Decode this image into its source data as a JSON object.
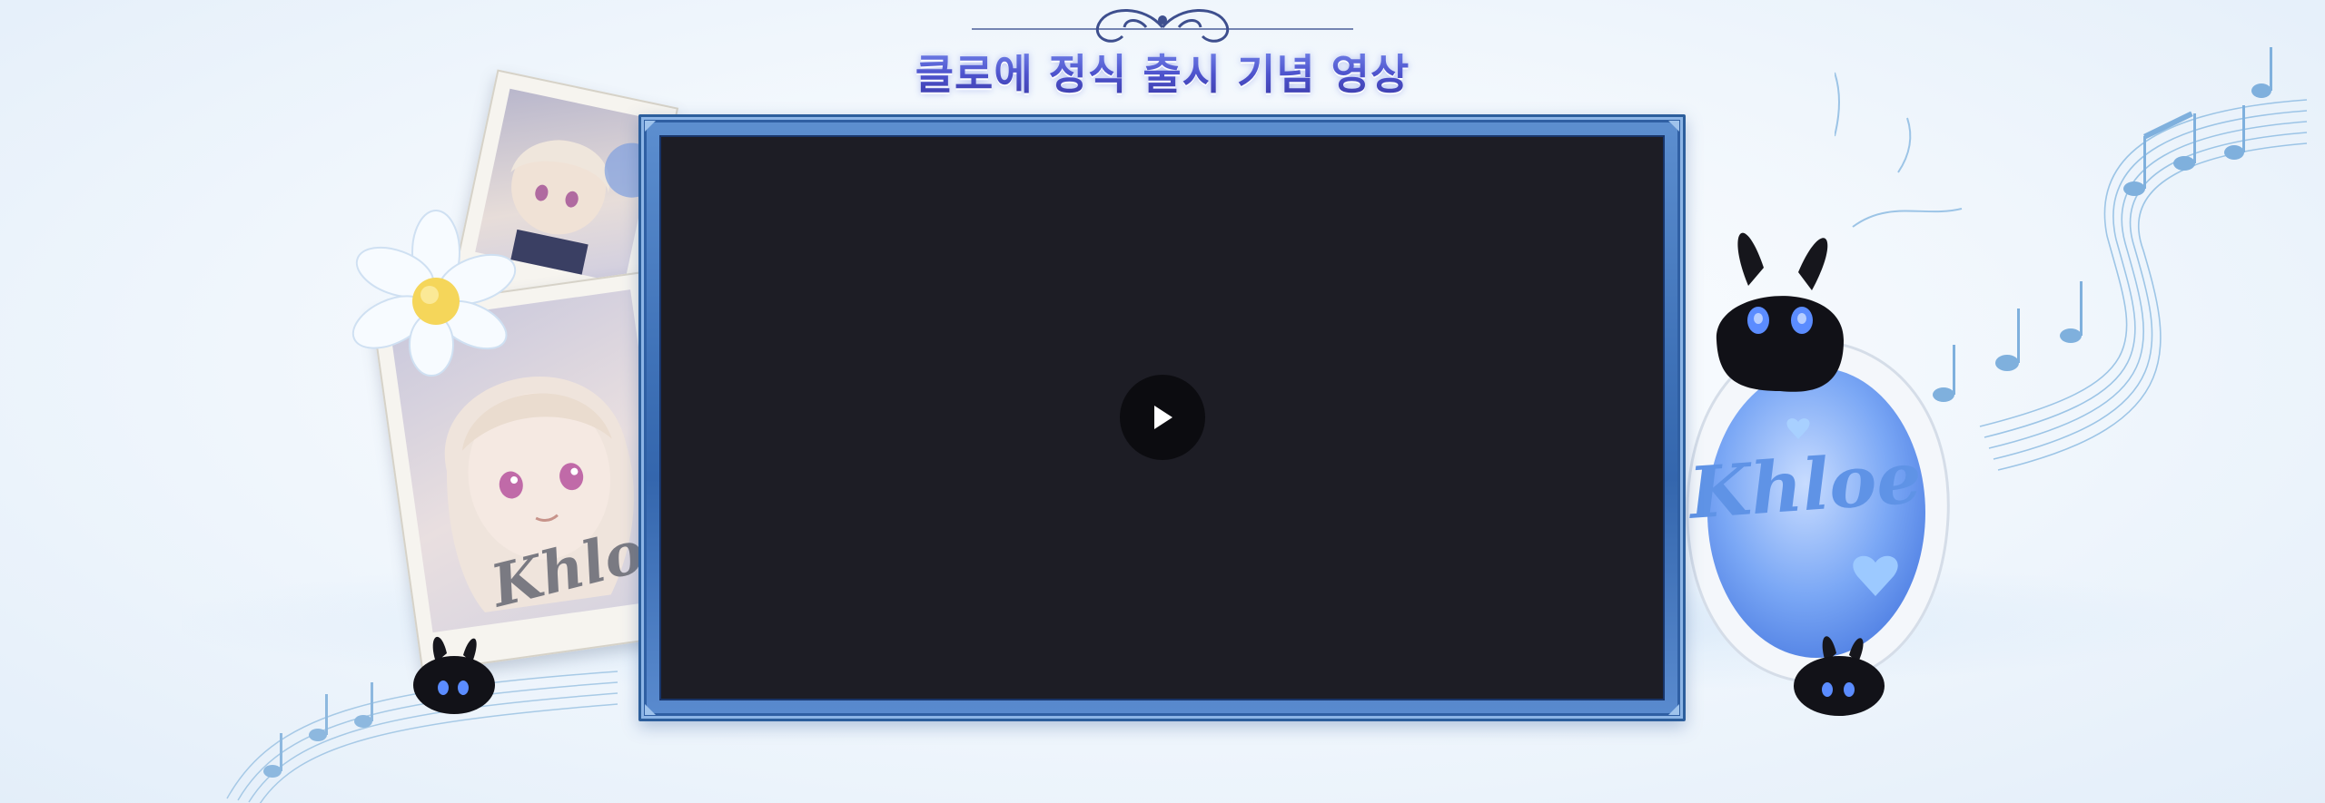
{
  "header": {
    "title": "클로에 정식 출시 기념 영상"
  },
  "video": {
    "play_label": "Play video"
  },
  "decor": {
    "signature": "Khloe"
  },
  "colors": {
    "title": "#4d52cc",
    "frame": "#3f72b8",
    "screen": "#1d1d25",
    "play": "#0c0c10",
    "notes": "#7fb0dd",
    "mascot_eyes": "#5b8cff"
  },
  "icons": [
    "play-icon",
    "title-ornament-icon",
    "daisy-flower-icon",
    "bunny-mascot-icon",
    "music-notes-icon",
    "heart-icon"
  ]
}
